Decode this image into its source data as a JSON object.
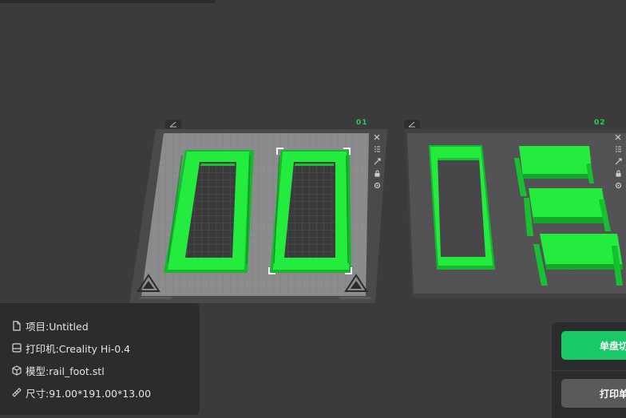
{
  "plates": [
    {
      "label": "01"
    },
    {
      "label": "02"
    }
  ],
  "info": {
    "project": "项目:Untitled",
    "printer": "打印机:Creality Hi-0.4",
    "model": "模型:rail_foot.stl",
    "size": "尺寸:91.00*191.00*13.00"
  },
  "actions": {
    "slice_label": "单盘切片",
    "print_label": "打印单盘"
  },
  "colors": {
    "background": "#3b3b3d",
    "model_green": "#1ee83c",
    "accent_green": "#18c965",
    "panel": "#2c2c2e"
  }
}
